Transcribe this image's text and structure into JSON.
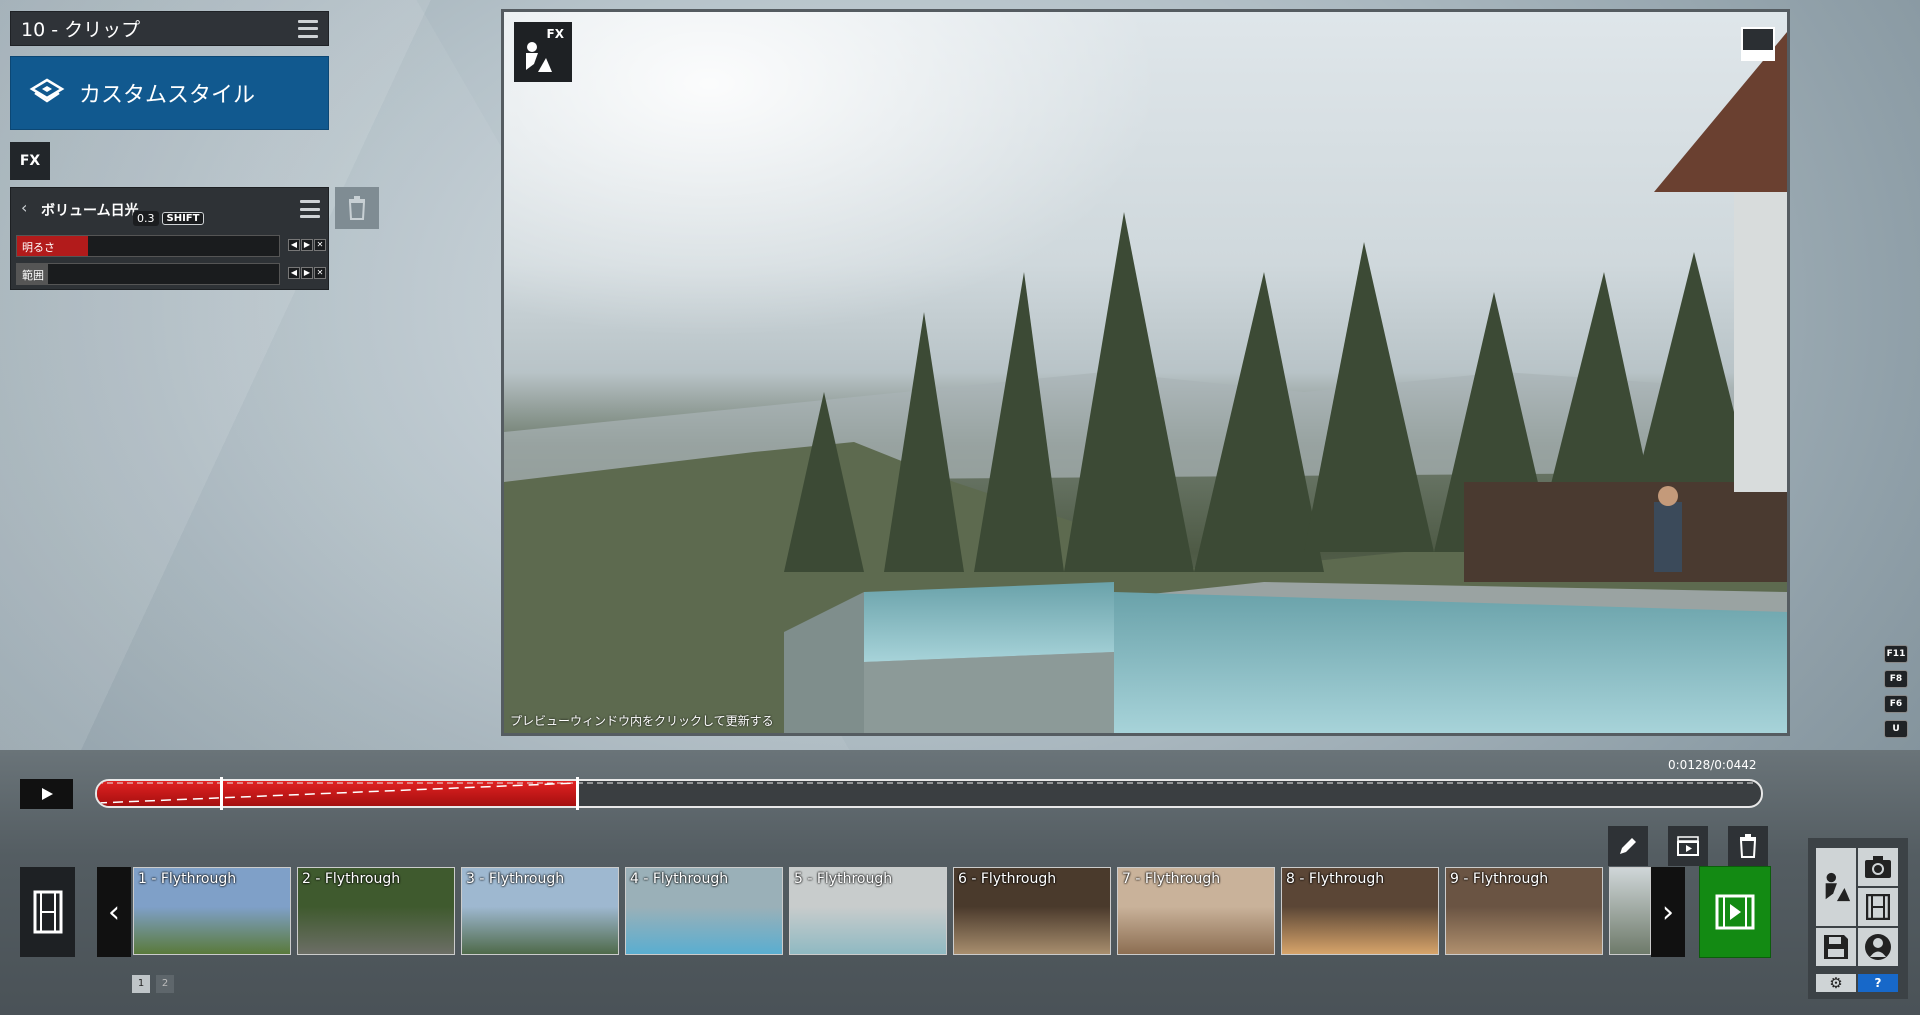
{
  "clip_panel": {
    "title": "10 - クリップ"
  },
  "style_button": {
    "label": "カスタムスタイル"
  },
  "fx_badge": "FX",
  "effect": {
    "name": "ボリューム日光",
    "shift_tip": {
      "value": "0.3",
      "key": "SHIFT"
    },
    "sliders": [
      {
        "label": "明るさ",
        "fill": 0.27
      },
      {
        "label": "範囲",
        "fill": 0.12
      }
    ]
  },
  "preview": {
    "fx_label": "FX",
    "hint": "プレビューウィンドウ内をクリックして更新する"
  },
  "fkeys": [
    "F11",
    "F8",
    "F6",
    "U"
  ],
  "timeline": {
    "time": "0:0128/0:0442",
    "progress": 0.289,
    "marker": 0.075
  },
  "clips": [
    {
      "label": "1 - Flythrough",
      "c1": "#7fa0c8",
      "c2": "#5a7a3b"
    },
    {
      "label": "2 - Flythrough",
      "c1": "#3f5a2e",
      "c2": "#6c6e66"
    },
    {
      "label": "3 - Flythrough",
      "c1": "#9eb8d0",
      "c2": "#4f6a4a"
    },
    {
      "label": "4 - Flythrough",
      "c1": "#9ab0b8",
      "c2": "#5aaed0"
    },
    {
      "label": "5 - Flythrough",
      "c1": "#c8cccc",
      "c2": "#8fb9c2"
    },
    {
      "label": "6 - Flythrough",
      "c1": "#4a3a2c",
      "c2": "#a88e6e"
    },
    {
      "label": "7 - Flythrough",
      "c1": "#c9b29a",
      "c2": "#8c6e52"
    },
    {
      "label": "8 - Flythrough",
      "c1": "#5b4636",
      "c2": "#d7a46a"
    },
    {
      "label": "9 - Flythrough",
      "c1": "#6a5443",
      "c2": "#b0906e"
    }
  ],
  "pages": [
    "1",
    "2"
  ]
}
